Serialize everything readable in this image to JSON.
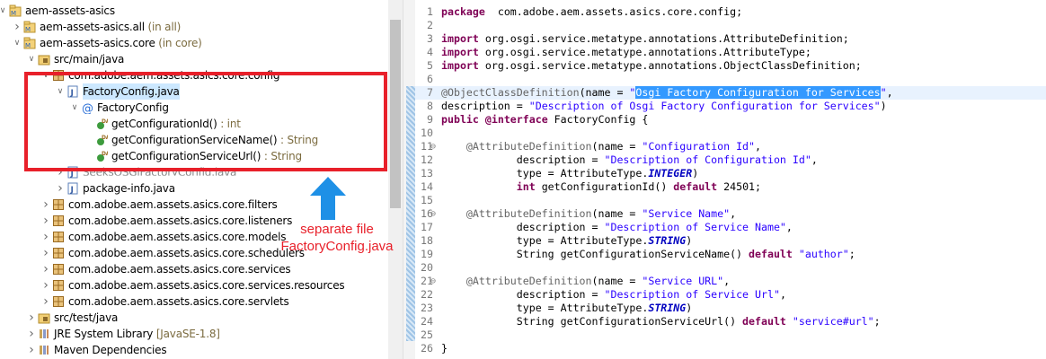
{
  "tree": {
    "items": [
      {
        "label": "aem-assets-asics",
        "suffix": "",
        "twisty": "v",
        "icon": "project-icon",
        "indent": 0
      },
      {
        "label": "aem-assets-asics.all",
        "suffix": " (in all)",
        "twisty": ">",
        "icon": "project-icon",
        "indent": 1
      },
      {
        "label": "aem-assets-asics.core",
        "suffix": " (in core)",
        "twisty": "v",
        "icon": "project-icon",
        "indent": 1
      },
      {
        "label": "src/main/java",
        "suffix": "",
        "twisty": "v",
        "icon": "source-folder-icon",
        "indent": 2
      },
      {
        "label": "com.adobe.aem.assets.asics.core.config",
        "suffix": "",
        "twisty": "v",
        "icon": "package-icon",
        "indent": 3
      },
      {
        "label": "FactoryConfig.java",
        "suffix": "",
        "twisty": "v",
        "icon": "java-file-icon",
        "indent": 4,
        "selected": true
      },
      {
        "label": "FactoryConfig",
        "suffix": "",
        "twisty": "v",
        "icon": "annotation-icon",
        "indent": 5
      },
      {
        "label": "getConfigurationId()",
        "suffix": " : int",
        "twisty": "",
        "icon": "method-icon",
        "indent": 6
      },
      {
        "label": "getConfigurationServiceName()",
        "suffix": " : String",
        "twisty": "",
        "icon": "method-icon",
        "indent": 6
      },
      {
        "label": "getConfigurationServiceUrl()",
        "suffix": " : String",
        "twisty": "",
        "icon": "method-icon",
        "indent": 6
      },
      {
        "label": "SeeksOSGiFactoryConfig.java",
        "suffix": "",
        "twisty": ">",
        "icon": "java-file-icon",
        "indent": 4,
        "obscured": true
      },
      {
        "label": "package-info.java",
        "suffix": "",
        "twisty": ">",
        "icon": "java-file-icon",
        "indent": 4
      },
      {
        "label": "com.adobe.aem.assets.asics.core.filters",
        "suffix": "",
        "twisty": ">",
        "icon": "package-icon",
        "indent": 3
      },
      {
        "label": "com.adobe.aem.assets.asics.core.listeners",
        "suffix": "",
        "twisty": ">",
        "icon": "package-icon",
        "indent": 3
      },
      {
        "label": "com.adobe.aem.assets.asics.core.models",
        "suffix": "",
        "twisty": ">",
        "icon": "package-icon",
        "indent": 3
      },
      {
        "label": "com.adobe.aem.assets.asics.core.schedulers",
        "suffix": "",
        "twisty": ">",
        "icon": "package-icon",
        "indent": 3
      },
      {
        "label": "com.adobe.aem.assets.asics.core.services",
        "suffix": "",
        "twisty": ">",
        "icon": "package-icon",
        "indent": 3
      },
      {
        "label": "com.adobe.aem.assets.asics.core.services.resources",
        "suffix": "",
        "twisty": ">",
        "icon": "package-icon",
        "indent": 3
      },
      {
        "label": "com.adobe.aem.assets.asics.core.servlets",
        "suffix": "",
        "twisty": ">",
        "icon": "package-icon",
        "indent": 3
      },
      {
        "label": "src/test/java",
        "suffix": "",
        "twisty": ">",
        "icon": "source-folder-icon",
        "indent": 2
      },
      {
        "label": "JRE System Library",
        "suffix": " [JavaSE-1.8]",
        "twisty": ">",
        "icon": "library-icon",
        "indent": 2
      },
      {
        "label": "Maven Dependencies",
        "suffix": "",
        "twisty": ">",
        "icon": "library-icon",
        "indent": 2
      }
    ]
  },
  "annotation": {
    "text_line1": "separate file",
    "text_line2": "FactoryConfig.java"
  },
  "colors": {
    "highlight_box": "#e8202a",
    "arrow": "#1e90e6",
    "keyword": "#7f0055",
    "string": "#2a00ff",
    "annotation": "#646464",
    "selection": "#3399ff"
  },
  "editor": {
    "lines": [
      {
        "n": "1",
        "fold": "",
        "tokens": [
          [
            "kw",
            "package"
          ],
          [
            "",
            "  com.adobe.aem.assets.asics.core.config;"
          ]
        ]
      },
      {
        "n": "2",
        "fold": "",
        "tokens": []
      },
      {
        "n": "3",
        "fold": "",
        "tokens": [
          [
            "kw",
            "import"
          ],
          [
            "",
            " org.osgi.service.metatype.annotations.AttributeDefinition;"
          ]
        ]
      },
      {
        "n": "4",
        "fold": "",
        "tokens": [
          [
            "kw",
            "import"
          ],
          [
            "",
            " org.osgi.service.metatype.annotations.AttributeType;"
          ]
        ]
      },
      {
        "n": "5",
        "fold": "",
        "tokens": [
          [
            "kw",
            "import"
          ],
          [
            "",
            " org.osgi.service.metatype.annotations.ObjectClassDefinition;"
          ]
        ]
      },
      {
        "n": "6",
        "fold": "",
        "tokens": []
      },
      {
        "n": "7",
        "fold": "",
        "current": true,
        "tokens": [
          [
            "ann",
            "@ObjectClassDefinition"
          ],
          [
            "",
            "(name = "
          ],
          [
            "str",
            "\""
          ],
          [
            "hl",
            "Osgi Factory Configuration for Services"
          ],
          [
            "str",
            "\""
          ],
          [
            "",
            ","
          ]
        ]
      },
      {
        "n": "8",
        "fold": "",
        "tokens": [
          [
            "",
            "description = "
          ],
          [
            "str",
            "\"Description of Osgi Factory Configuration for Services\""
          ],
          [
            "",
            ")"
          ]
        ]
      },
      {
        "n": "9",
        "fold": "",
        "tokens": [
          [
            "kw",
            "public"
          ],
          [
            "",
            " "
          ],
          [
            "kw",
            "@interface"
          ],
          [
            "",
            " FactoryConfig {"
          ]
        ]
      },
      {
        "n": "10",
        "fold": "",
        "tokens": []
      },
      {
        "n": "11",
        "fold": "⊖",
        "tokens": [
          [
            "",
            "    "
          ],
          [
            "ann",
            "@AttributeDefinition"
          ],
          [
            "",
            "(name = "
          ],
          [
            "str",
            "\"Configuration Id\""
          ],
          [
            "",
            ","
          ]
        ]
      },
      {
        "n": "12",
        "fold": "",
        "tokens": [
          [
            "",
            "            description = "
          ],
          [
            "str",
            "\"Description of Configuration Id\""
          ],
          [
            "",
            ","
          ]
        ]
      },
      {
        "n": "13",
        "fold": "",
        "tokens": [
          [
            "",
            "            type = AttributeType."
          ],
          [
            "const",
            "INTEGER"
          ],
          [
            "",
            ")"
          ]
        ]
      },
      {
        "n": "14",
        "fold": "",
        "tokens": [
          [
            "",
            "            "
          ],
          [
            "kw",
            "int"
          ],
          [
            "",
            " getConfigurationId() "
          ],
          [
            "kw",
            "default"
          ],
          [
            "",
            " 24501;"
          ]
        ]
      },
      {
        "n": "15",
        "fold": "",
        "tokens": []
      },
      {
        "n": "16",
        "fold": "⊖",
        "tokens": [
          [
            "",
            "    "
          ],
          [
            "ann",
            "@AttributeDefinition"
          ],
          [
            "",
            "(name = "
          ],
          [
            "str",
            "\"Service Name\""
          ],
          [
            "",
            ","
          ]
        ]
      },
      {
        "n": "17",
        "fold": "",
        "tokens": [
          [
            "",
            "            description = "
          ],
          [
            "str",
            "\"Description of Service Name\""
          ],
          [
            "",
            ","
          ]
        ]
      },
      {
        "n": "18",
        "fold": "",
        "tokens": [
          [
            "",
            "            type = AttributeType."
          ],
          [
            "const",
            "STRING"
          ],
          [
            "",
            ")"
          ]
        ]
      },
      {
        "n": "19",
        "fold": "",
        "tokens": [
          [
            "",
            "            String getConfigurationServiceName() "
          ],
          [
            "kw",
            "default"
          ],
          [
            "",
            " "
          ],
          [
            "str",
            "\"author\""
          ],
          [
            "",
            ";"
          ]
        ]
      },
      {
        "n": "20",
        "fold": "",
        "tokens": []
      },
      {
        "n": "21",
        "fold": "⊖",
        "tokens": [
          [
            "",
            "    "
          ],
          [
            "ann",
            "@AttributeDefinition"
          ],
          [
            "",
            "(name = "
          ],
          [
            "str",
            "\"Service URL\""
          ],
          [
            "",
            ","
          ]
        ]
      },
      {
        "n": "22",
        "fold": "",
        "tokens": [
          [
            "",
            "            description = "
          ],
          [
            "str",
            "\"Description of Service Url\""
          ],
          [
            "",
            ","
          ]
        ]
      },
      {
        "n": "23",
        "fold": "",
        "tokens": [
          [
            "",
            "            type = AttributeType."
          ],
          [
            "const",
            "STRING"
          ],
          [
            "",
            ")"
          ]
        ]
      },
      {
        "n": "24",
        "fold": "",
        "tokens": [
          [
            "",
            "            String getConfigurationServiceUrl() "
          ],
          [
            "kw",
            "default"
          ],
          [
            "",
            " "
          ],
          [
            "str",
            "\"service#url\""
          ],
          [
            "",
            ";"
          ]
        ]
      },
      {
        "n": "25",
        "fold": "",
        "tokens": []
      },
      {
        "n": "26",
        "fold": "",
        "tokens": [
          [
            "",
            "}"
          ]
        ]
      }
    ]
  }
}
